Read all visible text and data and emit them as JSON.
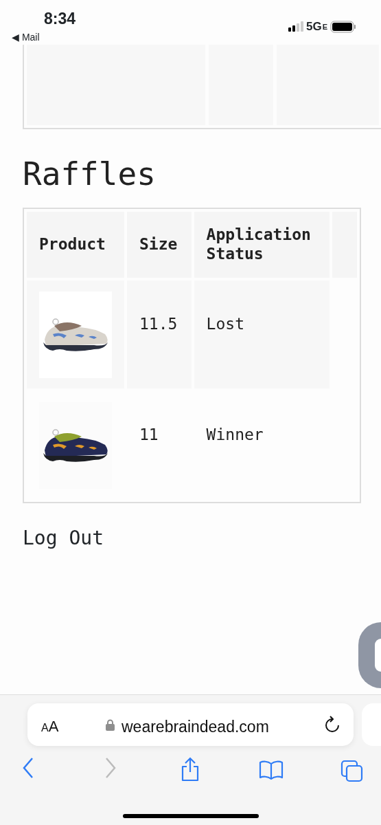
{
  "status_bar": {
    "time": "8:34",
    "back_link": "◀ Mail",
    "network": "5G",
    "network_badge": "E"
  },
  "heading": "Raffles",
  "table": {
    "columns": [
      "Product",
      "Size",
      "Application Status"
    ],
    "rows": [
      {
        "size": "11.5",
        "status": "Lost"
      },
      {
        "size": "11",
        "status": "Winner"
      }
    ]
  },
  "logout_link": "Log Out",
  "browser": {
    "text_size_button": "AA",
    "url": "wearebraindead.com"
  }
}
